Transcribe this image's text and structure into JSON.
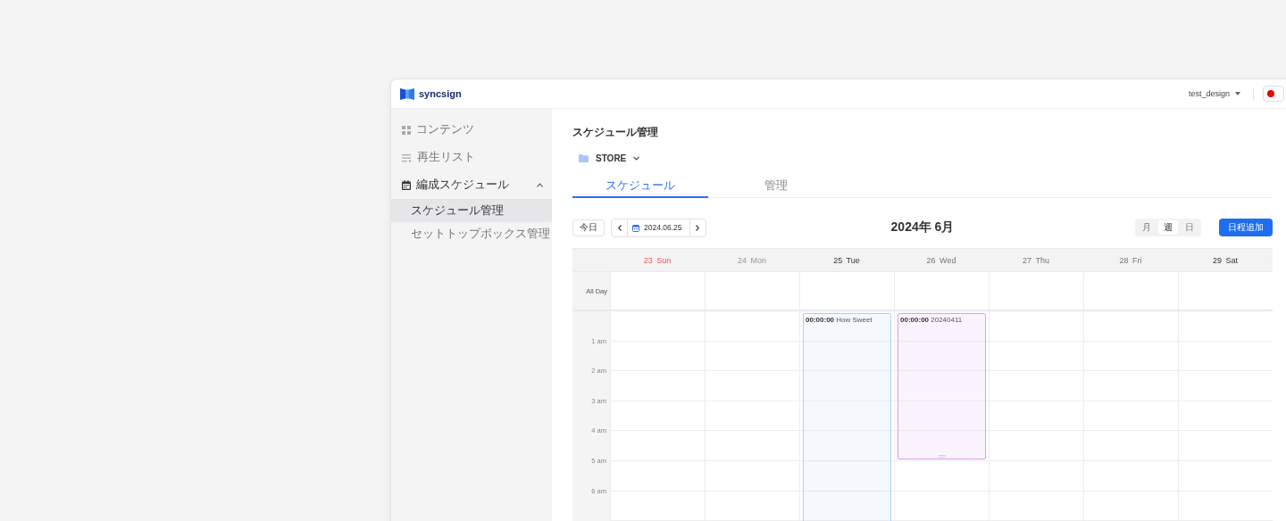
{
  "header": {
    "logo": "syncsign",
    "user": "test_design"
  },
  "sidebar": {
    "items": [
      {
        "label": "コンテンツ",
        "expanded": false
      },
      {
        "label": "再生リスト",
        "expanded": false
      },
      {
        "label": "編成スケジュール",
        "expanded": true,
        "children": [
          {
            "label": "スケジュール管理",
            "selected": true
          },
          {
            "label": "セットトップボックス管理",
            "selected": false
          }
        ]
      }
    ]
  },
  "page": {
    "title": "スケジュール管理",
    "folder": "STORE"
  },
  "tabs": [
    {
      "label": "スケジュール",
      "selected": true
    },
    {
      "label": "管理",
      "selected": false
    }
  ],
  "toolbar": {
    "today": "今日",
    "date": "2024.06.25",
    "title": "2024年 6月",
    "views": [
      {
        "label": "月",
        "selected": false
      },
      {
        "label": "週",
        "selected": true
      },
      {
        "label": "日",
        "selected": false
      }
    ],
    "add": "日程追加"
  },
  "calendar": {
    "all_day": "All Day",
    "days": [
      {
        "label": "23 Sun",
        "kind": "holiday"
      },
      {
        "label": "24 Mon",
        "kind": "past"
      },
      {
        "label": "25 Tue",
        "kind": "today",
        "events": [
          {
            "time": "00:00:00",
            "title": "How Sweet",
            "color": "#a9d0ee"
          }
        ]
      },
      {
        "label": "26 Wed",
        "kind": "normal",
        "events": [
          {
            "time": "00:00:00",
            "title": "20240411",
            "color": "#dd9cf2"
          }
        ]
      },
      {
        "label": "27 Thu",
        "kind": "normal"
      },
      {
        "label": "28 Fri",
        "kind": "normal"
      },
      {
        "label": "29 Sat",
        "kind": "today"
      }
    ],
    "hours": [
      "1 am",
      "2 am",
      "3 am",
      "4 am",
      "5 am",
      "6 am"
    ]
  }
}
